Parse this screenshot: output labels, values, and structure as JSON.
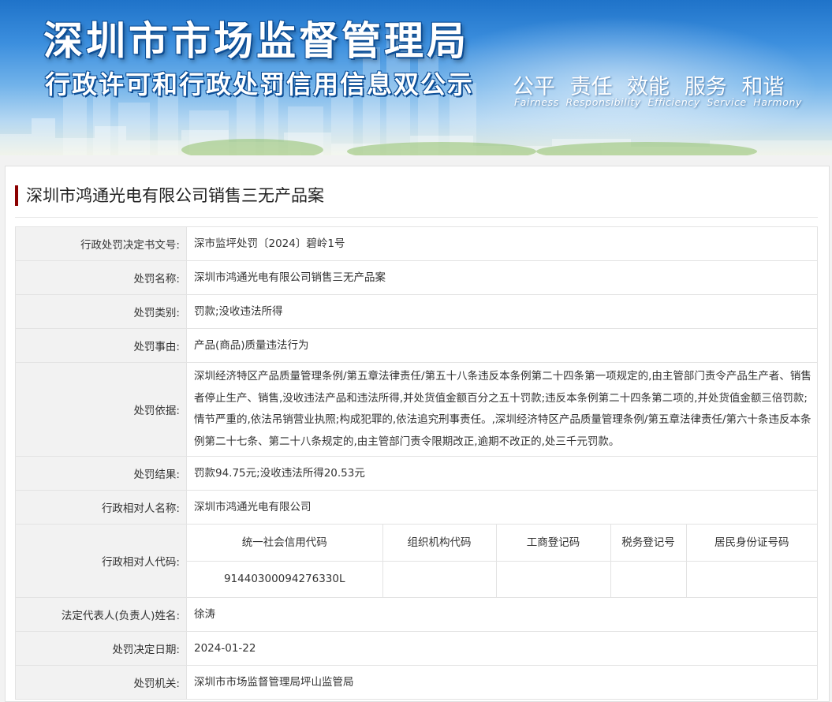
{
  "banner": {
    "title": "深圳市市场监督管理局",
    "subtitle": "行政许可和行政处罚信用信息双公示",
    "values_cn": "公平 责任 效能 服务 和谐",
    "values_en": "Fairness Responsibility Efficiency Service Harmony"
  },
  "case": {
    "title": "深圳市鸿通光电有限公司销售三无产品案"
  },
  "rows": {
    "decision_no": {
      "label": "行政处罚决定书文号:",
      "value": "深市监坪处罚〔2024〕碧岭1号"
    },
    "penalty_name": {
      "label": "处罚名称:",
      "value": "深圳市鸿通光电有限公司销售三无产品案"
    },
    "penalty_type": {
      "label": "处罚类别:",
      "value": "罚款;没收违法所得"
    },
    "penalty_reason": {
      "label": "处罚事由:",
      "value": "产品(商品)质量违法行为"
    },
    "penalty_basis": {
      "label": "处罚依据:",
      "value": "深圳经济特区产品质量管理条例/第五章法律责任/第五十八条违反本条例第二十四条第一项规定的,由主管部门责令产品生产者、销售者停止生产、销售,没收违法产品和违法所得,并处货值金额百分之五十罚款;违反本条例第二十四条第二项的,并处货值金额三倍罚款;情节严重的,依法吊销营业执照;构成犯罪的,依法追究刑事责任。,深圳经济特区产品质量管理条例/第五章法律责任/第六十条违反本条例第二十七条、第二十八条规定的,由主管部门责令限期改正,逾期不改正的,处三千元罚款。"
    },
    "penalty_result": {
      "label": "处罚结果:",
      "value": "罚款94.75元;没收违法所得20.53元"
    },
    "party_name": {
      "label": "行政相对人名称:",
      "value": "深圳市鸿通光电有限公司"
    },
    "party_codes": {
      "label": "行政相对人代码:",
      "headers": [
        "统一社会信用代码",
        "组织机构代码",
        "工商登记码",
        "税务登记号",
        "居民身份证号码"
      ],
      "values": [
        "91440300094276330L",
        "",
        "",
        "",
        ""
      ]
    },
    "legal_rep": {
      "label": "法定代表人(负责人)姓名:",
      "value": "徐涛"
    },
    "decision_date": {
      "label": "处罚决定日期:",
      "value": "2024-01-22"
    },
    "authority": {
      "label": "处罚机关:",
      "value": "深圳市市场监督管理局坪山监管局"
    }
  }
}
